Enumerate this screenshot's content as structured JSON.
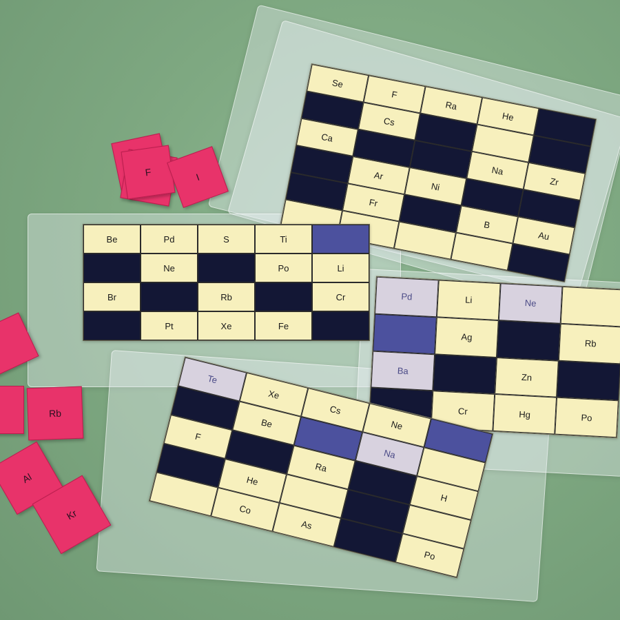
{
  "card_top_right": {
    "cells": [
      "Se",
      "F",
      "Ra",
      "He",
      "",
      "",
      "Cs",
      "",
      "",
      "",
      "Ca",
      "",
      "",
      "Na",
      "Zr",
      "",
      "Ar",
      "Ni",
      "",
      "",
      "",
      "Fr",
      "",
      "B",
      "Au",
      "",
      "",
      "",
      "",
      ""
    ]
  },
  "card_left": {
    "cells": [
      "Be",
      "Pd",
      "S",
      "Ti",
      "",
      "",
      "Ne",
      "",
      "Po",
      "Li",
      "Br",
      "",
      "Rb",
      "",
      "Cr",
      "",
      "Pt",
      "Xe",
      "Fe",
      ""
    ]
  },
  "card_right": {
    "cells": [
      "Pd",
      "Li",
      "Ne",
      "",
      "",
      "Ag",
      "",
      "Rb",
      "Ba",
      "",
      "Zn",
      "",
      "",
      "Cr",
      "Hg",
      "Po"
    ]
  },
  "card_bottom": {
    "cells": [
      "Te",
      "Xe",
      "Cs",
      "Ne",
      "",
      "",
      "Be",
      "",
      "Na",
      "",
      "F",
      "",
      "Ra",
      "",
      "H",
      "",
      "He",
      "",
      "",
      "",
      "",
      "Co",
      "As",
      "",
      "Po"
    ]
  },
  "chips": {
    "chip_f": "F",
    "chip_i": "I",
    "chip_rb": "Rb",
    "chip_al": "Al",
    "chip_kr": "Kr"
  },
  "colors": {
    "board": "#7fa982",
    "card": "#f7f0bd",
    "dark_cell": "#131735",
    "chip": "#e8336a"
  }
}
